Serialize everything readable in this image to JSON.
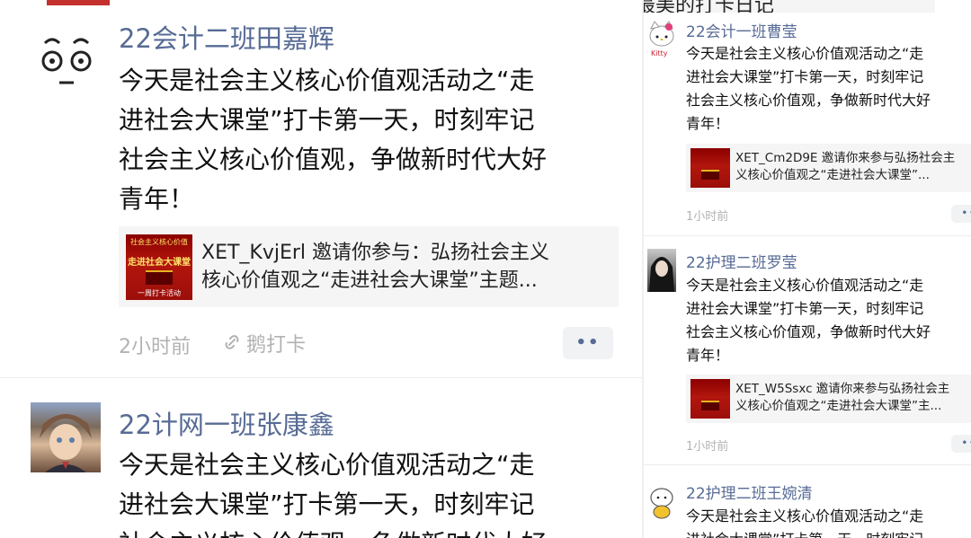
{
  "left": {
    "top_partial": {
      "name": "22会计二班田嘉辉",
      "text_lines": [
        "今天是社会主义核心价值观活动之“走",
        "进社会大课堂”打卡第一天，时刻牢记",
        "社会主义核心价值观，争做新时代大好",
        "青年！"
      ],
      "card": {
        "thumb_lines": [
          "社会主义核心价值",
          "走进社会大课堂",
          "一周打卡活动"
        ],
        "text_lines": [
          "XET_KvjErl 邀请你参与：弘扬社会主义",
          "核心价值观之“走进社会大课堂”主题..."
        ]
      },
      "time": "2小时前",
      "source": "鹅打卡",
      "more": "••",
      "source_icon": "link-icon"
    },
    "second": {
      "name": "22计网一班张康鑫",
      "text_lines": [
        "今天是社会主义核心价值观活动之“走",
        "进社会大课堂”打卡第一天，时刻牢记",
        "社会主义核心价值观，争做新时代大好"
      ]
    }
  },
  "right": {
    "top_fragment": "国际学院风采 最美的打卡日记",
    "posts": [
      {
        "name": "22会计一班曹莹",
        "text_lines": [
          "今天是社会主义核心价值观活动之“走",
          "进社会大课堂”打卡第一天，时刻牢记",
          "社会主义核心价值观，争做新时代大好",
          "青年！"
        ],
        "card_lines": [
          "XET_Cm2D9E 邀请你来参与弘扬社会主",
          "义核心价值观之“走进社会大课堂”..."
        ],
        "time": "1小时前",
        "more": "••"
      },
      {
        "name": "22护理二班罗莹",
        "text_lines": [
          "今天是社会主义核心价值观活动之“走",
          "进社会大课堂”打卡第一天，时刻牢记",
          "社会主义核心价值观，争做新时代大好",
          "青年！"
        ],
        "card_lines": [
          "XET_W5Ssxc 邀请你来参与弘扬社会主",
          "义核心价值观之“走进社会大课堂”主..."
        ],
        "time": "1小时前",
        "more": "••"
      },
      {
        "name": "22护理二班王婉清",
        "text_lines": [
          "今天是社会主义核心价值观活动之“走",
          "进社会大课堂”打卡第一天，时刻牢记"
        ]
      }
    ]
  },
  "colors": {
    "name": "#576b95",
    "meta": "#b2b2b2",
    "card_bg": "#f5f5f5",
    "thumb_red": "#b3160d"
  }
}
